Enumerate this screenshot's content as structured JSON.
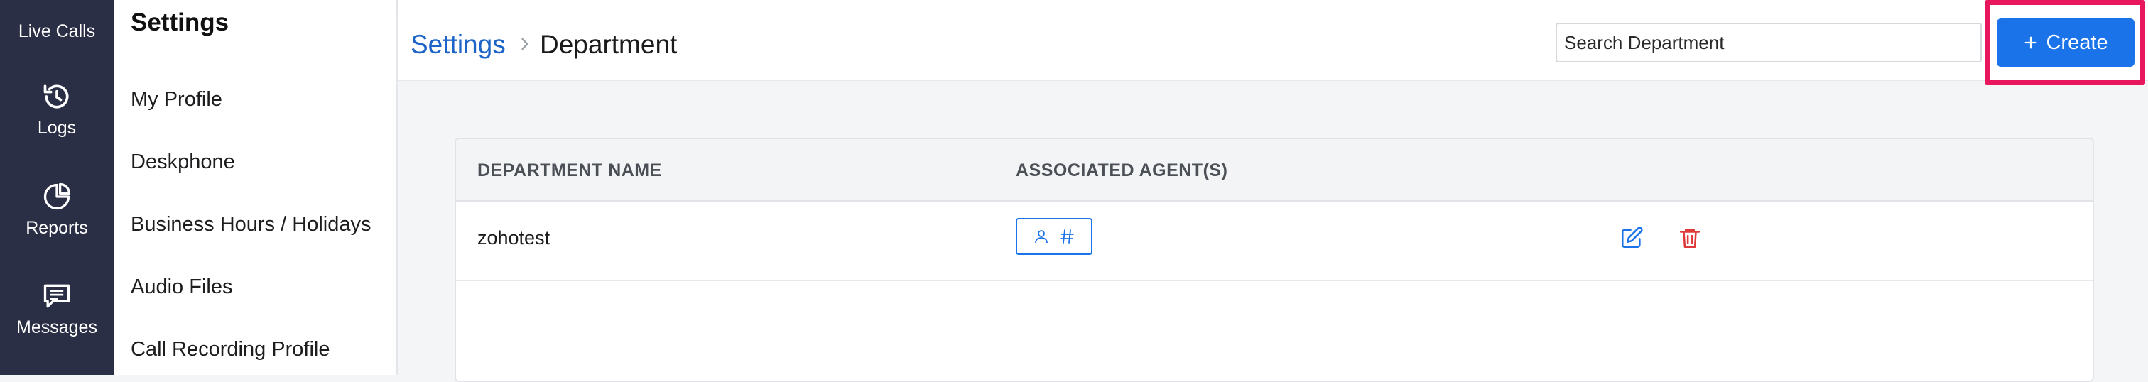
{
  "rail": {
    "items": [
      {
        "label": "Live Calls",
        "icon": "live-calls"
      },
      {
        "label": "Logs",
        "icon": "history-icon"
      },
      {
        "label": "Reports",
        "icon": "pie-chart-icon"
      },
      {
        "label": "Messages",
        "icon": "message-icon"
      }
    ]
  },
  "settings": {
    "title": "Settings",
    "items": [
      {
        "label": "My Profile"
      },
      {
        "label": "Deskphone"
      },
      {
        "label": "Business Hours / Holidays"
      },
      {
        "label": "Audio Files"
      },
      {
        "label": "Call Recording Profile"
      }
    ]
  },
  "header": {
    "breadcrumb_root": "Settings",
    "breadcrumb_current": "Department",
    "search_placeholder": "Search Department",
    "create_label": "Create"
  },
  "table": {
    "columns": [
      "DEPARTMENT NAME",
      "ASSOCIATED AGENT(S)"
    ],
    "rows": [
      {
        "name": "zohotest"
      }
    ]
  },
  "colors": {
    "rail_bg": "#2b2f45",
    "accent": "#1a73e8",
    "highlight": "#e8175d",
    "delete": "#e03a3a"
  }
}
